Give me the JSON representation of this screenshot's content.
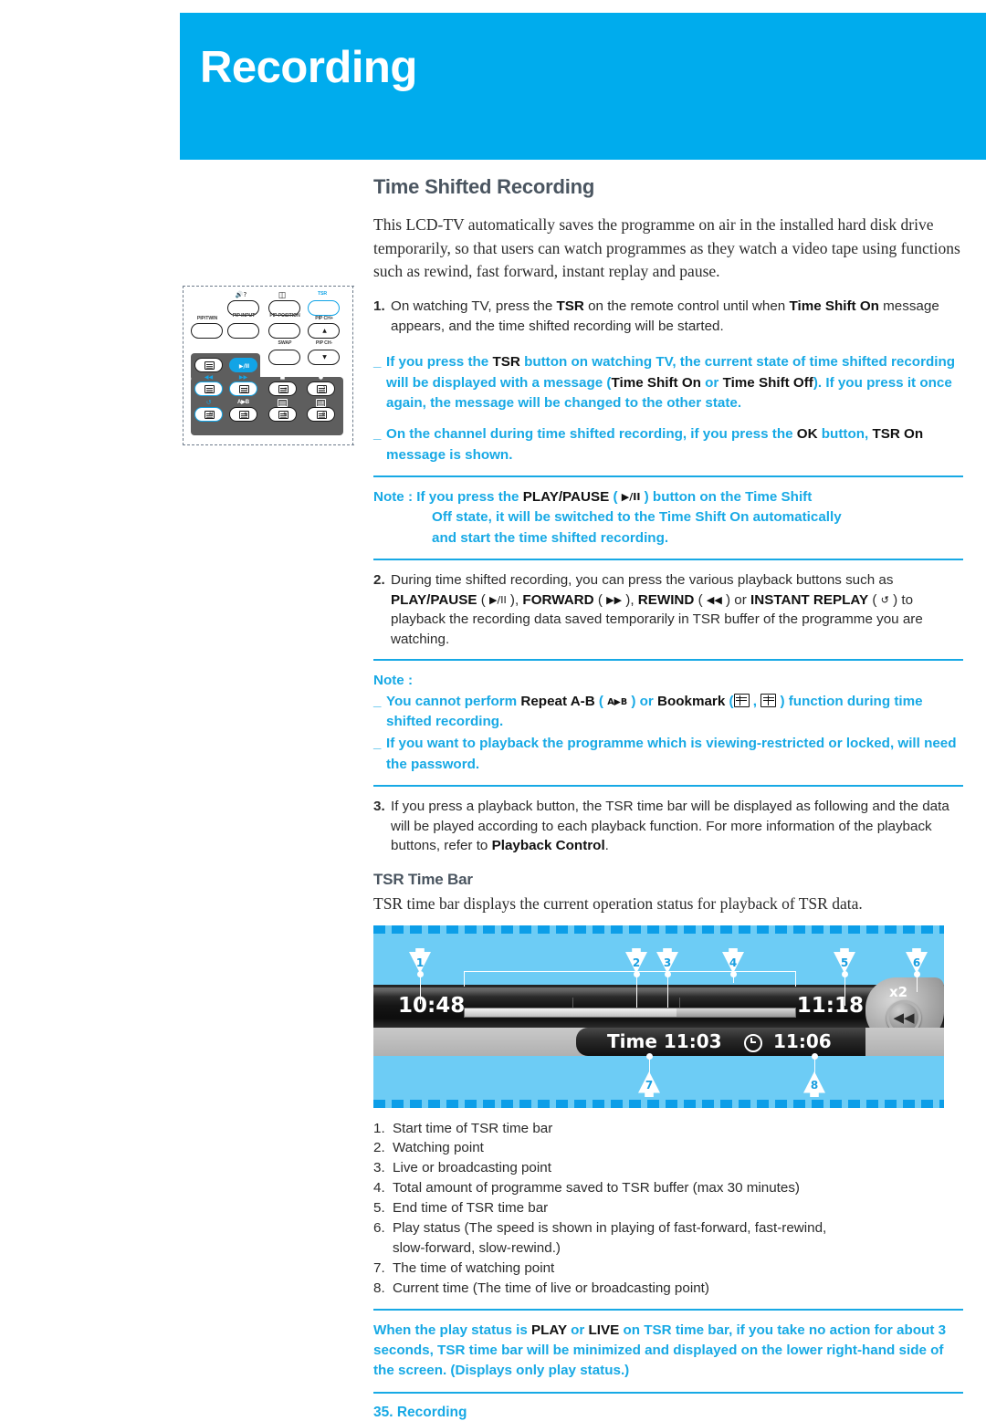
{
  "banner": {
    "title": "Recording",
    "color": "#00ACED"
  },
  "section": {
    "title": "Time Shifted Recording",
    "intro": "This LCD-TV automatically saves the programme on air in the installed hard disk drive temporarily, so that users can watch programmes as they watch a video tape using functions such as rewind, fast forward, instant replay and pause."
  },
  "steps": {
    "one": {
      "num": "1.",
      "p1": "On watching TV, press the ",
      "b1": "TSR",
      "p2": " on the remote control until when ",
      "b2": "Time Shift On",
      "p3": " message appears, and the time shifted recording will be started."
    },
    "two": {
      "num": "2.",
      "p1": "During time shifted recording, you can press the various playback buttons such as ",
      "b_playpause": "PLAY/PAUSE",
      "g_playpause": "▶/II",
      "b_forward": "FORWARD",
      "g_forward": "▶▶",
      "b_rewind": "REWIND",
      "g_rewind": "◀◀",
      "b_instant": "INSTANT REPLAY",
      "g_instant": "↺",
      "sep1": ", ",
      "sep2": ", ",
      "sep3": " or ",
      "p_tail": " to playback the recording data saved temporarily in TSR buffer of the programme you are watching."
    },
    "three": {
      "num": "3.",
      "p1": "If you press a playback button, the TSR time bar will be displayed as following and the data will be played according to each playback function. For more information of the playback buttons, refer to ",
      "b1": "Playback Control",
      "p2": "."
    }
  },
  "blue_notes": {
    "bullet_mark": "_",
    "n1": {
      "t1": "If you press the ",
      "b1": "TSR",
      "t2": " button on watching TV, the current state of time shifted recording will be displayed with a message (",
      "b2": "Time Shift On",
      "t3": " or ",
      "b3": "Time Shift Off",
      "t4": "). If you press it once again, the message will be changed to the other state."
    },
    "n2": {
      "t1": "On the channel during time shifted recording, if you press the ",
      "b1": "OK",
      "t2": " button, ",
      "b2": "TSR On",
      "t3": " message is shown."
    },
    "note_label": "Note : ",
    "note_play": {
      "t1": "If you press the ",
      "b1": "PLAY/PAUSE",
      "g1": "▶/II",
      "t2": " button on the Time Shift",
      "l2": "Off state, it will be switched to the Time Shift On automatically",
      "l3": "and start the time shifted recording."
    },
    "note2_label": "Note :",
    "note2_a": {
      "t1": "You cannot perform ",
      "b1": "Repeat A-B",
      "g1": "A▶B",
      "t2": " or ",
      "b2": "Bookmark",
      "t3": " function during time shifted recording."
    },
    "note2_b": "If you want to playback the programme which is viewing-restricted or locked, will need the password.",
    "final": {
      "t1": "When the play status is ",
      "b1": "PLAY",
      "t2": " or ",
      "b2": "LIVE",
      "t3": " on TSR time bar, if you take no action for about 3 seconds, TSR time bar will be minimized and displayed on the lower right-hand side of the screen. (Displays only play status.)"
    }
  },
  "tsr": {
    "heading": "TSR Time Bar",
    "caption": "TSR time bar displays the current operation status for playback of TSR data.",
    "figure": {
      "start_time": "10:48",
      "end_time": "11:18",
      "watch_time_label": "Time 11:03",
      "current_time": "11:06",
      "speed": "x2",
      "speed_icon": "◀◀",
      "clock_icon": "clock",
      "callouts": [
        "1",
        "2",
        "3",
        "4",
        "5",
        "6",
        "7",
        "8"
      ]
    },
    "legend": [
      {
        "n": "1.",
        "t": "Start time of TSR time bar"
      },
      {
        "n": "2.",
        "t": "Watching point"
      },
      {
        "n": "3.",
        "t": "Live or broadcasting point"
      },
      {
        "n": "4.",
        "t": "Total amount of programme saved to TSR buffer (max 30 minutes)"
      },
      {
        "n": "5.",
        "t": "End time of TSR time bar"
      },
      {
        "n": "6.",
        "t": "Play status (The speed is shown in playing of fast-forward, fast-rewind,"
      },
      {
        "n": "",
        "t": "slow-forward, slow-rewind.)"
      },
      {
        "n": "7.",
        "t": "The time of watching point"
      },
      {
        "n": "8.",
        "t": "Current time (The time of live or broadcasting point)"
      }
    ]
  },
  "footer": {
    "text": "35. Recording"
  },
  "remote": {
    "labels": {
      "pip_twin": "PIP/TWIN",
      "pip_input": "PIP INPUT",
      "pip_position": "PIP POSITION",
      "tsr": "TSR",
      "pip_ch_up": "PIP CH+",
      "pip_ch_dn": "PIP CH-",
      "swap": "SWAP",
      "ab": "A▶B"
    },
    "icons": {
      "mute": "⌗?",
      "screen": "screen-icon",
      "up": "▲",
      "down": "▼",
      "rewind": "◀◀",
      "forward": "▶▶",
      "playpause": "▶/II",
      "replay": "↺",
      "stop": "■",
      "record": "●"
    }
  }
}
